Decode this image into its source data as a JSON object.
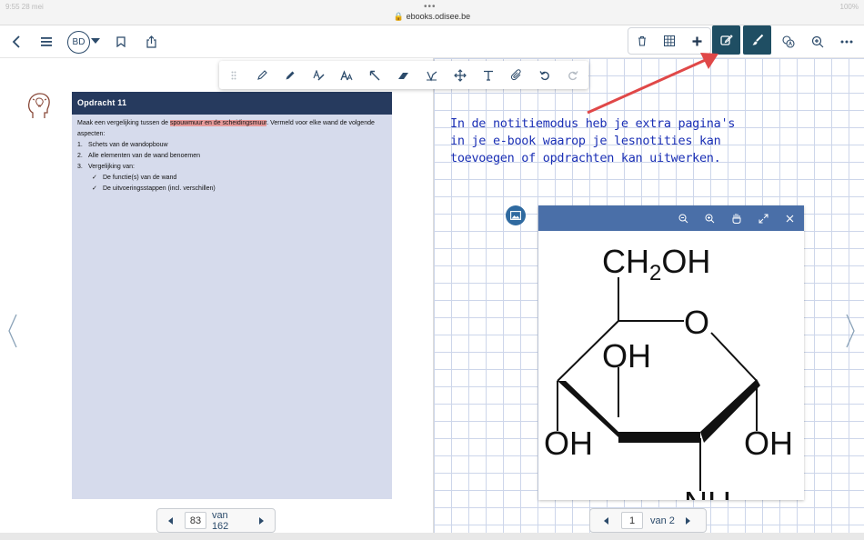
{
  "browser": {
    "url": "ebooks.odisee.be",
    "time": "9:55 28 mei",
    "status": "100%"
  },
  "toolbar": {
    "user_initials": "BD"
  },
  "assignment": {
    "title": "Opdracht 11",
    "intro_before": "Maak een vergelijking tussen de ",
    "intro_highlight": "spouwmuur en de scheidingsmuur",
    "intro_after": ". Vermeld voor elke wand de volgende aspecten:",
    "items": [
      {
        "n": "1.",
        "text": "Schets van de wandopbouw"
      },
      {
        "n": "2.",
        "text": "Alle elementen van de wand benoemen"
      },
      {
        "n": "3.",
        "text": "Vergelijking van:"
      }
    ],
    "subitems": [
      {
        "mark": "✓",
        "text": "De functie(s) van de wand"
      },
      {
        "mark": "✓",
        "text": "De uitvoeringsstappen (incl. verschillen)"
      }
    ]
  },
  "left_pager": {
    "page": "83",
    "of_label": "van 162"
  },
  "right_pager": {
    "page": "1",
    "of_label": "van 2"
  },
  "note": {
    "lines": [
      "In de notitiemodus heb je extra pagina's",
      "in je e-book waarop je lesnotities kan",
      "toevoegen of opdrachten kan uitwerken."
    ]
  },
  "molecule": {
    "top_group": "CH2OH",
    "ring_o": "O",
    "oh_mid": "OH",
    "oh_left": "OH",
    "oh_right": "OH",
    "nh_partial": "NH"
  },
  "colors": {
    "accent_dark": "#1f4e63",
    "icon": "#2c4b6b",
    "assignment_header": "#263a5e",
    "assignment_bg": "#d6dbec",
    "highlight": "#e79a9a",
    "note_text": "#1a2fb5",
    "arrow": "#e04848",
    "window_bar": "#4a6fa8"
  }
}
